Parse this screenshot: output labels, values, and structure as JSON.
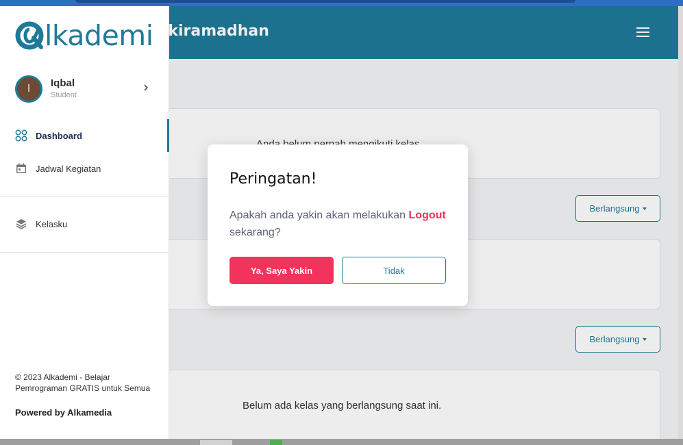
{
  "header": {
    "title": "al Rizkiramadhan"
  },
  "sidebar": {
    "logo_text": "lkademi",
    "profile": {
      "initial": "I",
      "name": "Iqbal",
      "role": "Student"
    },
    "items": [
      {
        "label": "Dashboard",
        "icon": "dashboard-grid-icon",
        "active": true
      },
      {
        "label": "Jadwal Kegiatan",
        "icon": "calendar-icon",
        "active": false
      },
      {
        "label": "Kelasku",
        "icon": "layers-icon",
        "active": false
      }
    ],
    "footer": {
      "copyright": "© 2023 Alkademi - Belajar Pemrograman GRATIS untuk Semua",
      "powered": "Powered by Alkamedia"
    }
  },
  "main": {
    "card1_text": "Anda belum pernah mengikuti kelas",
    "dropdown1_label": "Berlangsung",
    "dropdown2_label": "Berlangsung",
    "card3_text": "Belum ada kelas yang berlangsung saat ini."
  },
  "modal": {
    "title": "Peringatan!",
    "message_before": "Apakah anda yakin akan melakukan ",
    "message_highlight": "Logout",
    "message_after": " sekarang?",
    "confirm_label": "Ya, Saya Yakin",
    "cancel_label": "Tidak"
  },
  "colors": {
    "brand": "#1f7a9a",
    "danger": "#f2335c"
  }
}
